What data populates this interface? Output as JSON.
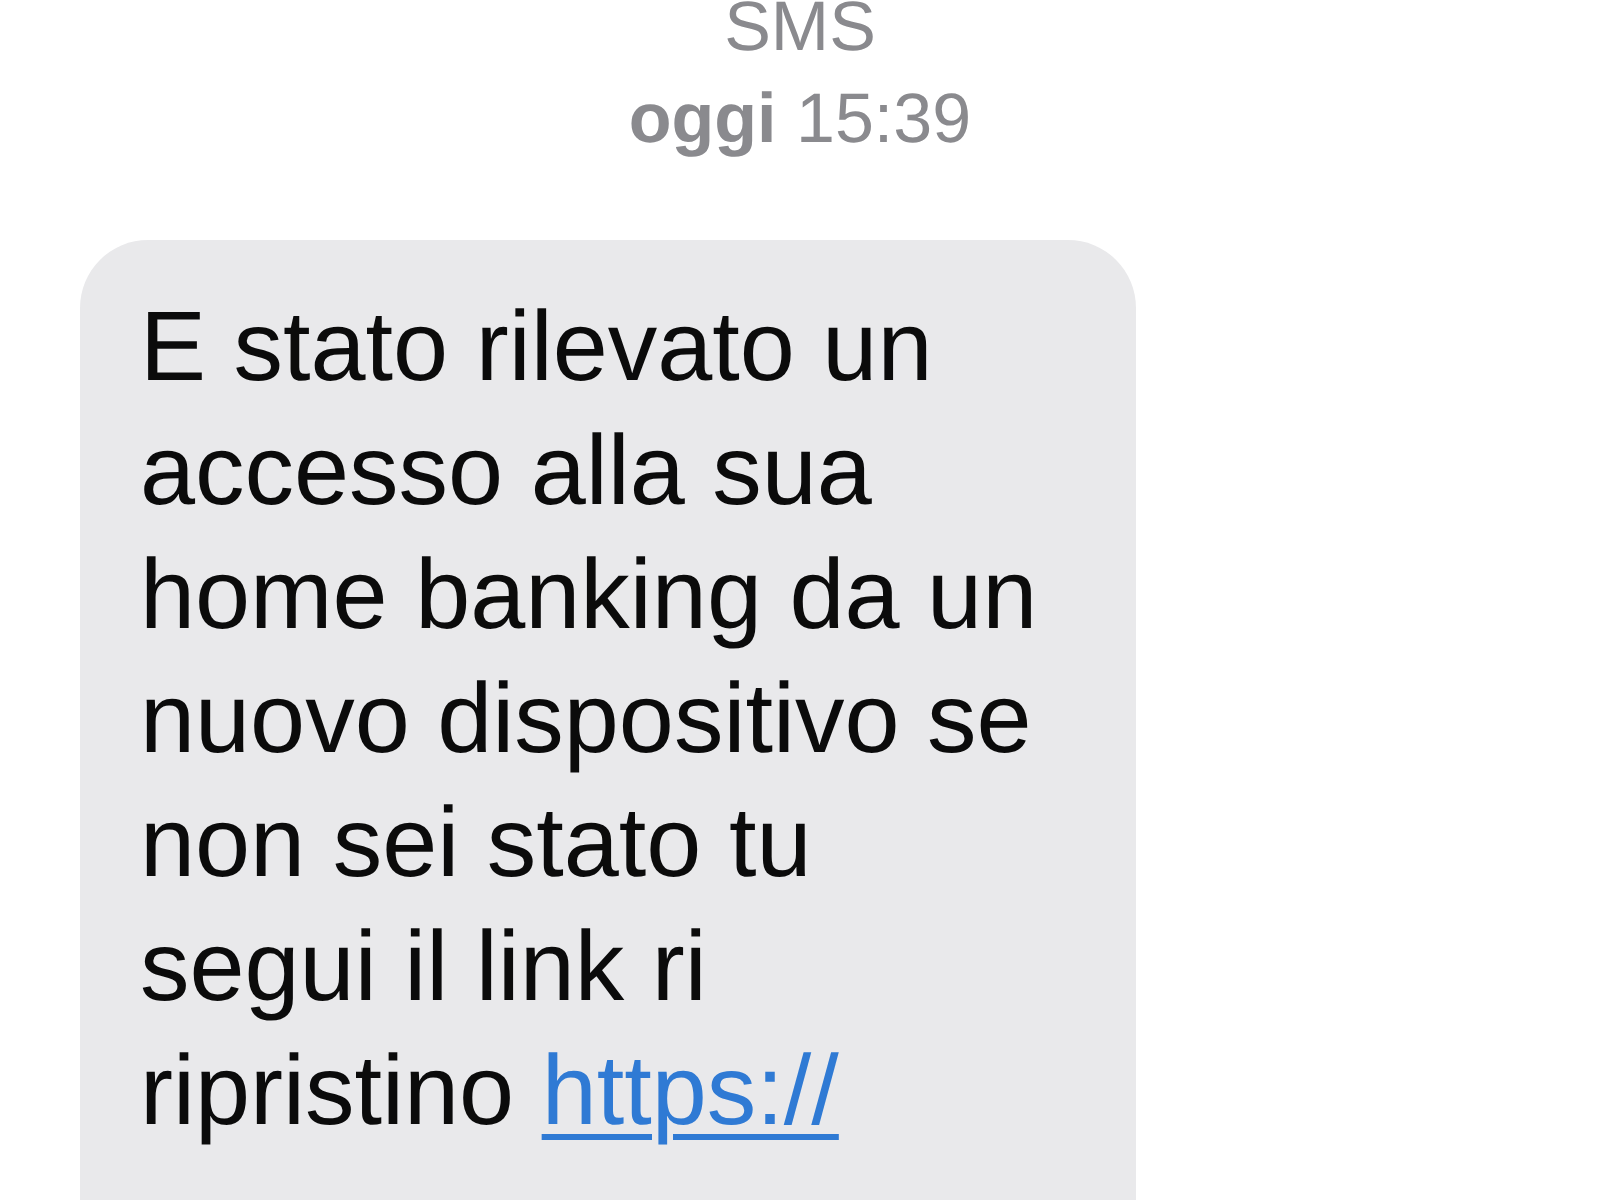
{
  "header": {
    "service": "SMS",
    "timestamp": "**oggi** 15:39"
  },
  "messages": [
    {
      "kind": "received",
      "text": "E stato rilevato un accesso alla sua home banking da un nuovo dispositivo se non sei stato tu segui il link ri ripristino",
      "link": "https://"
    }
  ]
}
